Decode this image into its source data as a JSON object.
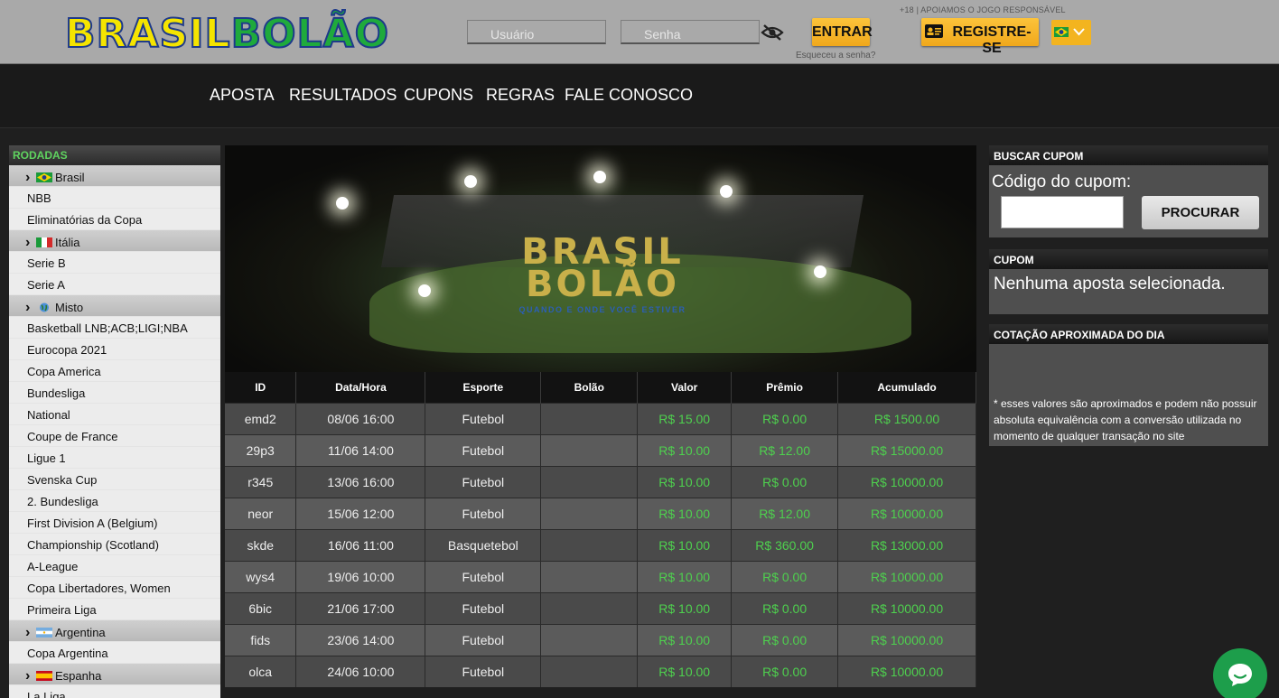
{
  "header": {
    "logo_part1": "BRASIL",
    "logo_part2": "BOLÃO",
    "username_placeholder": "Usuário",
    "password_placeholder": "Senha",
    "login_label": "ENTRAR",
    "forgot_label": "Esqueceu a senha?",
    "age_notice": "+18 | APOIAMOS O JOGO RESPONSÁVEL",
    "register_label": "REGISTRE-SE"
  },
  "nav": [
    "APOSTA",
    "RESULTADOS",
    "CUPONS",
    "REGRAS",
    "FALE CONOSCO"
  ],
  "sidebar": {
    "title": "RODADAS",
    "items": [
      {
        "label": "Brasil",
        "type": "country",
        "flag": "br"
      },
      {
        "label": "NBB",
        "type": "league"
      },
      {
        "label": "Eliminatórias da Copa",
        "type": "league"
      },
      {
        "label": "Itália",
        "type": "country",
        "flag": "it"
      },
      {
        "label": "Serie B",
        "type": "league"
      },
      {
        "label": "Serie A",
        "type": "league"
      },
      {
        "label": "Misto",
        "type": "country",
        "flag": "globe"
      },
      {
        "label": "Basketball LNB;ACB;LIGI;NBA",
        "type": "league"
      },
      {
        "label": "Eurocopa 2021",
        "type": "league"
      },
      {
        "label": "Copa America",
        "type": "league"
      },
      {
        "label": "Bundesliga",
        "type": "league"
      },
      {
        "label": "National",
        "type": "league"
      },
      {
        "label": "Coupe de France",
        "type": "league"
      },
      {
        "label": "Ligue 1",
        "type": "league"
      },
      {
        "label": "Svenska Cup",
        "type": "league"
      },
      {
        "label": "2. Bundesliga",
        "type": "league"
      },
      {
        "label": "First Division A (Belgium)",
        "type": "league"
      },
      {
        "label": "Championship (Scotland)",
        "type": "league"
      },
      {
        "label": "A-League",
        "type": "league"
      },
      {
        "label": "Copa Libertadores, Women",
        "type": "league"
      },
      {
        "label": "Primeira Liga",
        "type": "league"
      },
      {
        "label": "Argentina",
        "type": "country",
        "flag": "ar"
      },
      {
        "label": "Copa Argentina",
        "type": "league"
      },
      {
        "label": "Espanha",
        "type": "country",
        "flag": "es"
      },
      {
        "label": "La Liga",
        "type": "league"
      }
    ]
  },
  "banner": {
    "title_line1": "BRASIL",
    "title_line2": "BOLÃO",
    "subtitle": "QUANDO E ONDE VOCÊ ESTIVER"
  },
  "table": {
    "columns": [
      "ID",
      "Data/Hora",
      "Esporte",
      "Bolão",
      "Valor",
      "Prêmio",
      "Acumulado"
    ],
    "rows": [
      [
        "emd2",
        "08/06 16:00",
        "Futebol",
        "",
        "R$ 15.00",
        "R$ 0.00",
        "R$ 1500.00"
      ],
      [
        "29p3",
        "11/06 14:00",
        "Futebol",
        "",
        "R$ 10.00",
        "R$ 12.00",
        "R$ 15000.00"
      ],
      [
        "r345",
        "13/06 16:00",
        "Futebol",
        "",
        "R$ 10.00",
        "R$ 0.00",
        "R$ 10000.00"
      ],
      [
        "neor",
        "15/06 12:00",
        "Futebol",
        "",
        "R$ 10.00",
        "R$ 12.00",
        "R$ 10000.00"
      ],
      [
        "skde",
        "16/06 11:00",
        "Basquetebol",
        "",
        "R$ 10.00",
        "R$ 360.00",
        "R$ 13000.00"
      ],
      [
        "wys4",
        "19/06 10:00",
        "Futebol",
        "",
        "R$ 10.00",
        "R$ 0.00",
        "R$ 10000.00"
      ],
      [
        "6bic",
        "21/06 17:00",
        "Futebol",
        "",
        "R$ 10.00",
        "R$ 0.00",
        "R$ 10000.00"
      ],
      [
        "fids",
        "23/06 14:00",
        "Futebol",
        "",
        "R$ 10.00",
        "R$ 0.00",
        "R$ 10000.00"
      ],
      [
        "olca",
        "24/06 10:00",
        "Futebol",
        "",
        "R$ 10.00",
        "R$ 0.00",
        "R$ 10000.00"
      ]
    ]
  },
  "right": {
    "search_title": "BUSCAR CUPOM",
    "code_label": "Código do cupom:",
    "search_button": "PROCURAR",
    "coupon_title": "CUPOM",
    "coupon_empty": "Nenhuma aposta selecionada.",
    "quote_title": "COTAÇÃO APROXIMADA DO DIA",
    "quote_note": "* esses valores são aproximados e podem não possuir absoluta equivalência com a conversão utilizada no momento de qualquer transação no site"
  },
  "colors": {
    "accent": "#f3b41f",
    "money": "#4ed04e",
    "rodadas": "#5fd35f",
    "chat": "#1d9e4b"
  },
  "icons": [
    "eye-off-icon",
    "id-card-icon",
    "brazil-flag-icon",
    "chevron-down-icon",
    "chat-icon"
  ]
}
